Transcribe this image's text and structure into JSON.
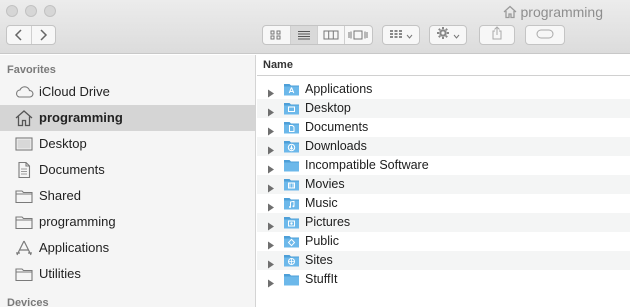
{
  "window": {
    "title": "programming",
    "title_icon": "home-icon"
  },
  "toolbar": {
    "back_icon": "chevron-left-icon",
    "forward_icon": "chevron-right-icon",
    "view_modes": [
      "icon-view-icon",
      "list-view-icon",
      "column-view-icon",
      "cover-flow-icon"
    ],
    "active_view": "list-view-icon",
    "arrange_icon": "arrange-grid-icon",
    "action_icon": "gear-icon",
    "share_icon": "share-icon",
    "tags_icon": "tag-icon"
  },
  "sidebar": {
    "favorites_heading": "Favorites",
    "devices_heading": "Devices",
    "items": [
      {
        "label": "iCloud Drive",
        "icon": "cloud-icon",
        "selected": false
      },
      {
        "label": "programming",
        "icon": "home-icon",
        "selected": true
      },
      {
        "label": "Desktop",
        "icon": "desktop-icon",
        "selected": false
      },
      {
        "label": "Documents",
        "icon": "document-icon",
        "selected": false
      },
      {
        "label": "Shared",
        "icon": "folder-icon",
        "selected": false
      },
      {
        "label": "programming",
        "icon": "folder-icon",
        "selected": false
      },
      {
        "label": "Applications",
        "icon": "applications-icon",
        "selected": false
      },
      {
        "label": "Utilities",
        "icon": "folder-icon",
        "selected": false
      }
    ]
  },
  "list": {
    "column_name": "Name",
    "rows": [
      {
        "label": "Applications",
        "icon": "applications-folder-icon"
      },
      {
        "label": "Desktop",
        "icon": "desktop-folder-icon"
      },
      {
        "label": "Documents",
        "icon": "documents-folder-icon"
      },
      {
        "label": "Downloads",
        "icon": "downloads-folder-icon"
      },
      {
        "label": "Incompatible Software",
        "icon": "folder-icon"
      },
      {
        "label": "Movies",
        "icon": "movies-folder-icon"
      },
      {
        "label": "Music",
        "icon": "music-folder-icon"
      },
      {
        "label": "Pictures",
        "icon": "pictures-folder-icon"
      },
      {
        "label": "Public",
        "icon": "public-folder-icon"
      },
      {
        "label": "Sites",
        "icon": "sites-folder-icon"
      },
      {
        "label": "StuffIt",
        "icon": "folder-icon"
      }
    ]
  },
  "colors": {
    "folder_blue": "#6cb8ea",
    "folder_blue_dark": "#4d9fd8",
    "selection_gray": "#d5d5d5",
    "sidebar_bg": "#f5f5f5"
  }
}
